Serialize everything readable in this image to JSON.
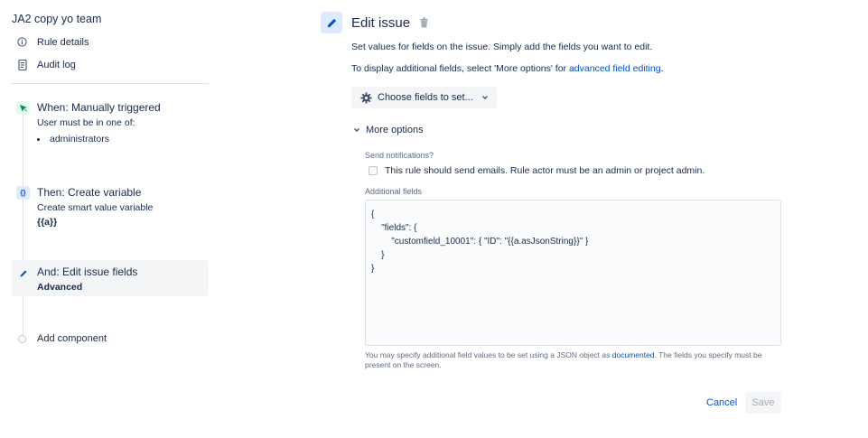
{
  "sidebar": {
    "rule_title": "JA2 copy yo team",
    "nav": {
      "rule_details": "Rule details",
      "audit_log": "Audit log"
    },
    "steps": {
      "when": {
        "title": "When: Manually triggered",
        "sub": "User must be in one of:",
        "items": [
          "administrators"
        ]
      },
      "then": {
        "title": "Then: Create variable",
        "sub": "Create smart value variable",
        "value": "{{a}}"
      },
      "and": {
        "title": "And: Edit issue fields",
        "value": "Advanced"
      }
    },
    "add_component": "Add component"
  },
  "main": {
    "title": "Edit issue",
    "desc1": "Set values for fields on the issue. Simply add the fields you want to edit.",
    "desc2_prefix": "To display additional fields, select 'More options' for ",
    "desc2_link": "advanced field editing",
    "desc2_suffix": ".",
    "choose_fields": "Choose fields to set...",
    "more_options": "More options",
    "send_notifications_label": "Send notifications?",
    "send_notifications_text": "This rule should send emails. Rule actor must be an admin or project admin.",
    "send_notifications_checked": false,
    "additional_fields_label": "Additional fields",
    "additional_fields_value": "{\n    \"fields\": {\n        \"customfield_10001\": { \"ID\": \"{{a.asJsonString}}\" }\n    }\n}",
    "help_prefix": "You may specify additional field values to be set using a JSON object as ",
    "help_link": "documented",
    "help_suffix": ". The fields you specify must be present on the screen.",
    "cancel": "Cancel",
    "save": "Save"
  },
  "colors": {
    "link": "#0052cc",
    "text": "#172b4d",
    "muted": "#5e6c84",
    "trigger_green": "#00875a",
    "selected_bg": "#f4f5f7"
  }
}
